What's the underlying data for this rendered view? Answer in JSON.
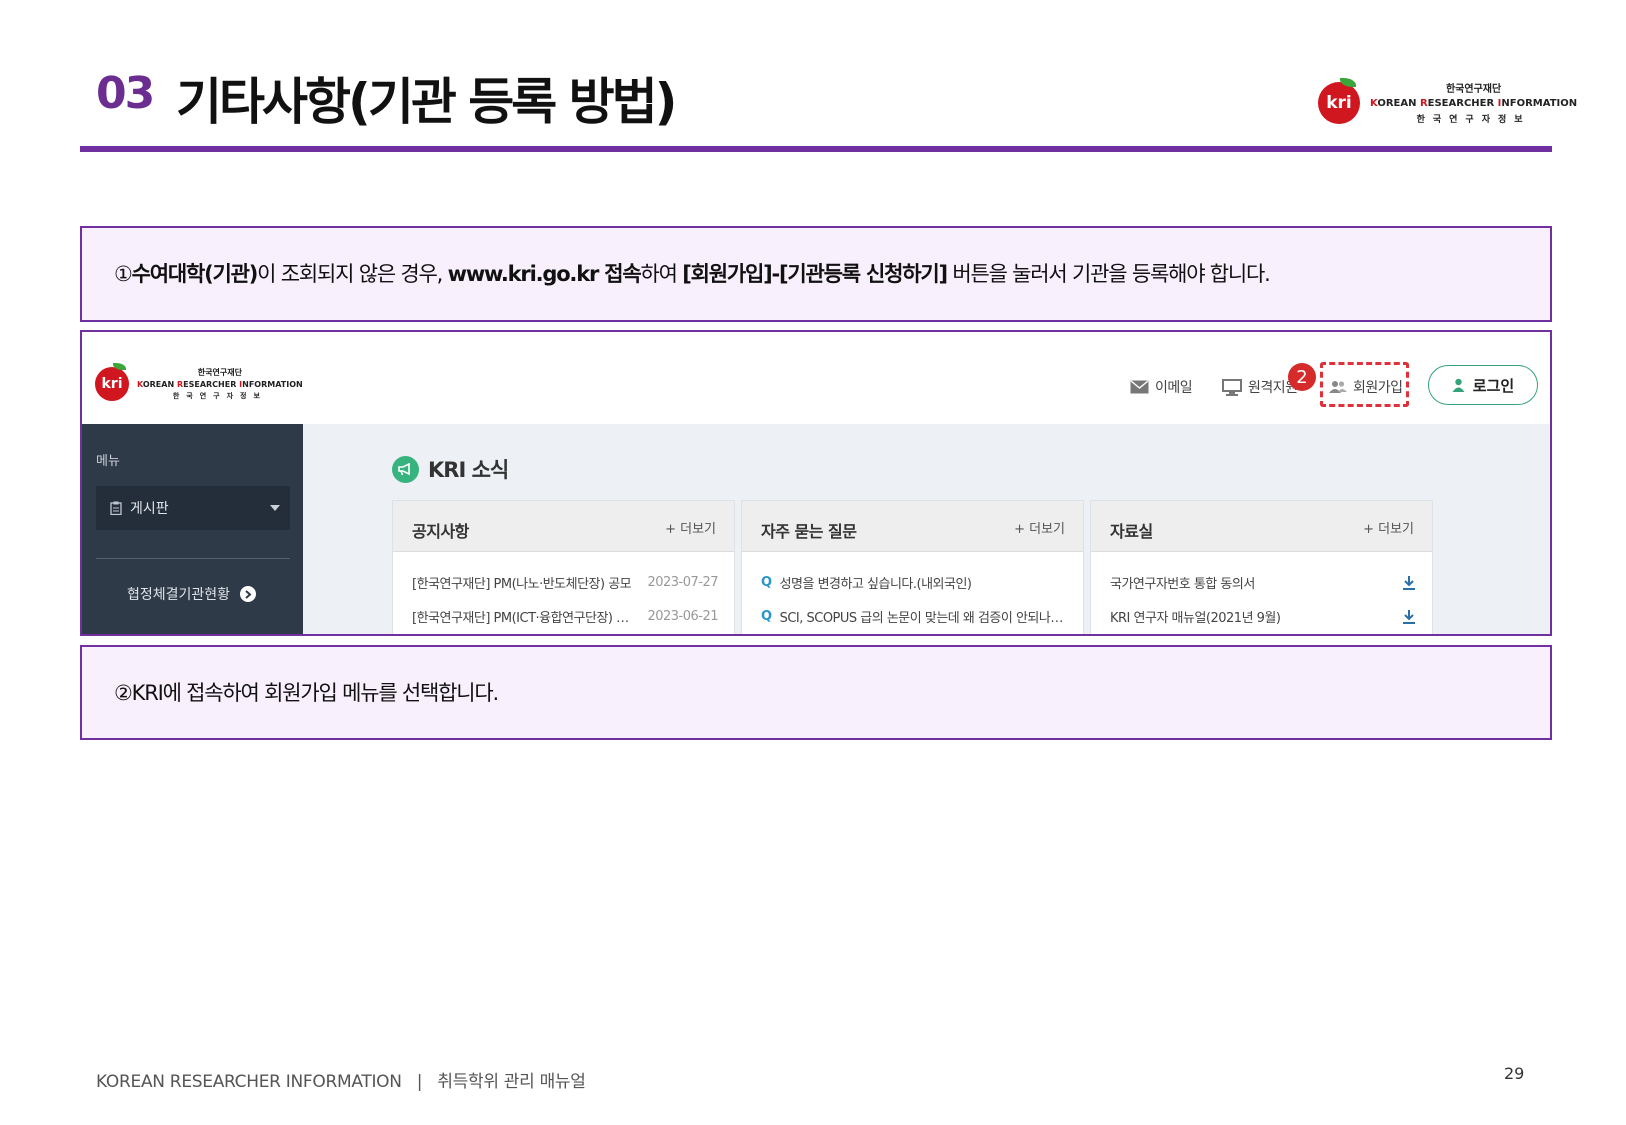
{
  "header": {
    "section_number": "03",
    "section_title": "기타사항(기관 등록 방법)"
  },
  "brand": {
    "logo_mark": "kri",
    "korean_name": "한국연구재단",
    "english_name_parts": [
      "K",
      "OREAN ",
      "R",
      "ESEARCHER ",
      "I",
      "NFORMATION"
    ],
    "korean_sub": "한국연구자정보",
    "colors": {
      "accent_purple": "#7030a0",
      "kri_red": "#d0161e",
      "leaf_green": "#3aa63a"
    }
  },
  "step1": {
    "prefix": "①",
    "bold1": "수여대학(기관)",
    "text1": "이 조회되지 않은 경우, ",
    "bold2": "www.kri.go.kr 접속",
    "text2": "하여 ",
    "bold3": "[회원가입]-[기관등록 신청하기]",
    "text3": " 버튼을 눌러서 기관을 등록해야 합니다."
  },
  "step2": {
    "text": "②KRI에 접속하여 회원가입 메뉴를 선택합니다."
  },
  "screenshot": {
    "top_menu": {
      "email": "이메일",
      "remote": "원격지원",
      "join": "회원가입",
      "login": "로그인",
      "callout_number": "2",
      "icons": [
        "mail-icon",
        "monitor-icon",
        "users-icon",
        "user-icon"
      ]
    },
    "sidebar": {
      "menu_label": "메뉴",
      "board_select": "게시판",
      "agreement_link": "협정체결기관현황"
    },
    "news": {
      "title": "KRI 소식",
      "panels": [
        {
          "title": "공지사항",
          "more": "+ 더보기",
          "items": [
            {
              "text": "[한국연구재단] PM(나노·반도체단장) 공모",
              "date": "2023-07-27"
            },
            {
              "text": "[한국연구재단] PM(ICT·융합연구단장) 공모",
              "date": "2023-06-21"
            }
          ]
        },
        {
          "title": "자주 묻는 질문",
          "more": "+ 더보기",
          "items": [
            {
              "q": "Q",
              "text": "성명을 변경하고 싶습니다.(내외국인)"
            },
            {
              "q": "Q",
              "text": "SCI, SCOPUS 급의 논문이 맞는데 왜 검증이 안되나요?"
            }
          ]
        },
        {
          "title": "자료실",
          "more": "+ 더보기",
          "items": [
            {
              "text": "국가연구자번호 통합 동의서"
            },
            {
              "text": "KRI 연구자 매뉴얼(2021년 9월)"
            }
          ]
        }
      ]
    }
  },
  "footer": {
    "left": "KOREAN RESEARCHER INFORMATION",
    "separator": "|",
    "manual": "취득학위 관리 매뉴얼",
    "page": "29"
  }
}
